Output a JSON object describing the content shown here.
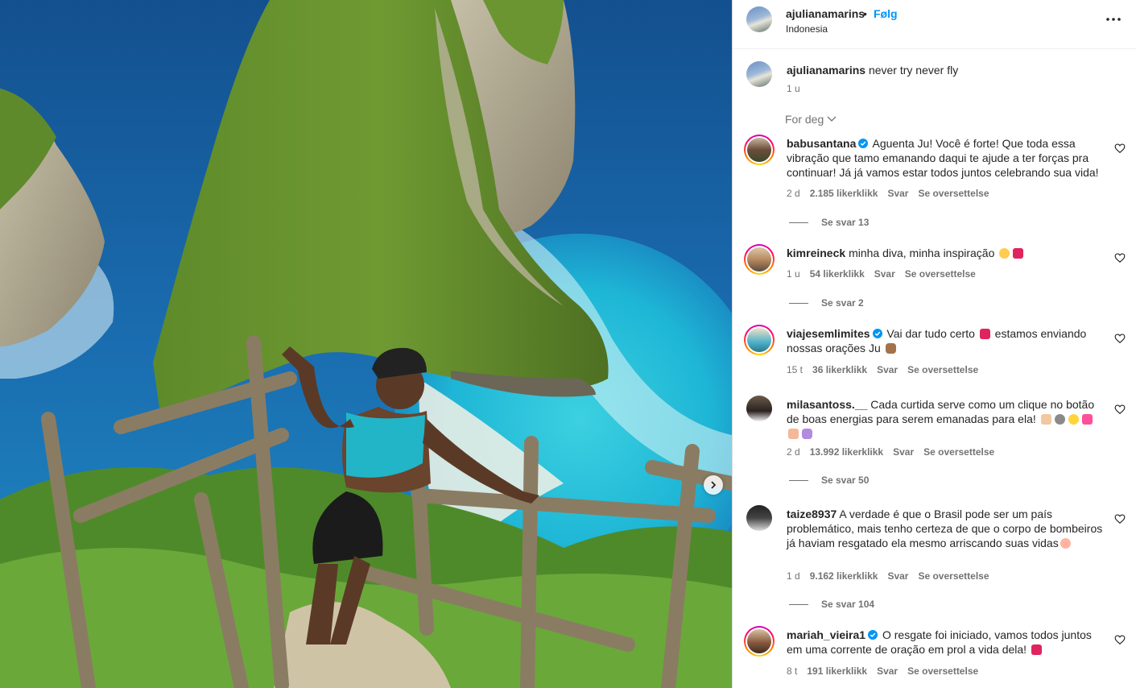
{
  "post": {
    "username": "ajulianamarins",
    "separator": "•",
    "follow_label": "Følg",
    "location": "Indonesia",
    "caption": "never try never fly",
    "caption_time": "1 u",
    "sort_label": "For deg"
  },
  "comments": [
    {
      "username": "babusantana",
      "verified": true,
      "text": "Aguenta Ju! Você é forte! Que toda essa vibração que tamo emanando daqui te ajude a ter forças pra continuar! Já já vamos estar todos juntos celebrando sua vida!",
      "time": "2 d",
      "likes": "2.185 likerklikk",
      "reply": "Svar",
      "translate": "Se oversettelse",
      "replies": "Se svar 13"
    },
    {
      "username": "kimreineck",
      "verified": false,
      "text": "minha diva, minha inspiração",
      "time": "1 u",
      "likes": "54 likerklikk",
      "reply": "Svar",
      "translate": "Se oversettelse",
      "replies": "Se svar 2"
    },
    {
      "username": "viajesemlimites",
      "verified": true,
      "text": "Vai dar tudo certo",
      "text2": "estamos enviando nossas orações Ju",
      "time": "15 t",
      "likes": "36 likerklikk",
      "reply": "Svar",
      "translate": "Se oversettelse"
    },
    {
      "username": "milasantoss.__",
      "verified": false,
      "text": "Cada curtida serve como um clique no botão de boas energias para serem emanadas para ela!",
      "time": "2 d",
      "likes": "13.992 likerklikk",
      "reply": "Svar",
      "translate": "Se oversettelse",
      "replies": "Se svar 50"
    },
    {
      "username": "taize8937",
      "verified": false,
      "text": "A verdade é que o Brasil pode ser um país problemático, mais tenho certeza de que o corpo de bombeiros já haviam resgatado ela mesmo arriscando suas vidas",
      "time": "1 d",
      "likes": "9.162 likerklikk",
      "reply": "Svar",
      "translate": "Se oversettelse",
      "replies": "Se svar 104"
    },
    {
      "username": "mariah_vieira1",
      "verified": true,
      "text": "O resgate foi iniciado, vamos todos juntos em uma corrente de oração em prol a vida dela!",
      "time": "8 t",
      "likes": "191 likerklikk",
      "reply": "Svar",
      "translate": "Se oversettelse"
    }
  ],
  "icons": {
    "more": "more-options-icon",
    "chevron": "chevron-down-icon",
    "verified": "verified-badge-icon",
    "like": "heart-outline-icon",
    "next": "chevron-right-icon"
  },
  "colors": {
    "follow": "#0095f6",
    "verified": "#0095f6",
    "muted": "#737373",
    "text": "#262626"
  }
}
